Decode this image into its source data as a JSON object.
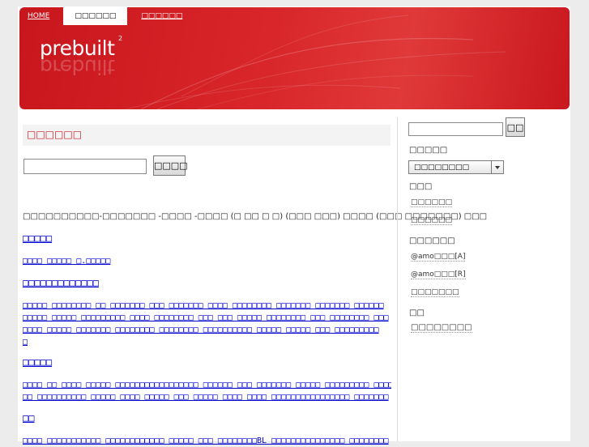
{
  "nav": {
    "home": "HOME",
    "tab_active": "□□□□□□",
    "tab_other": "□□□□□□"
  },
  "brand": {
    "name": "prebuilt",
    "superscript": "2"
  },
  "main": {
    "title": "□□□□□□",
    "search_button": "□□□□",
    "description": "□□□□□□□□□□-□□□□□□□ -□□□□ -□□□□ (□ □□ □ □) (□□□ □□□) □□□□ (□□□ □□□□□□□) □□□",
    "items": [
      {
        "kind": "heading",
        "lines": [
          "□□□□□"
        ]
      },
      {
        "kind": "para",
        "lines": [
          "□□□□ □□□□□ □.□□□□□"
        ]
      },
      {
        "kind": "heading",
        "lines": [
          "□□□□□□□□□□□□□"
        ]
      },
      {
        "kind": "para",
        "lines": [
          "□□□□□ □□□□□□□□ □□ □□□□□□□ □□□ □□□□□□□ □□□□ □□□□□□□□ □□□□□□□ □□□□□□□ □□□□□□",
          "□□□□□ □□□□□ □□□□□□□□□ □□□□ □□□□□□□□ □□□ □□□ □□□□□ □□□□□□□□ □□□ □□□□□□□□ □□□",
          "□□□□ □□□□□ □□□□□□□ □□□□□□□□ □□□□□□□□ □□□□□□□□□□ □□□□□ □□□□□ □□□ □□□□□□□□□",
          "□"
        ]
      },
      {
        "kind": "heading",
        "lines": [
          "□□□□□"
        ]
      },
      {
        "kind": "para",
        "lines": [
          "□□□□ □□ □□□□ □□□□□ □□□□□□□□□□□□□□□□□ □□□□□□ □□□ □□□□□□□ □□□□□ □□□□□□□□□ □□□□",
          "□□ □□□□□□□□□□ □□□□□ □□□□ □□□□□ □□□ □□□□□ □□□□ □□□□ □□□□□□□□□□□□□□□□ □□□□□□□"
        ]
      },
      {
        "kind": "heading",
        "lines": [
          "□□"
        ]
      },
      {
        "kind": "para",
        "lines": [
          "□□□□ □□□□□□□□□□□ □□□□□□□□□□□□ □□□□□ □□□ □□□□□□□□BL □□□□□□□□□□□□□□□ □□□□□□□□"
        ]
      }
    ]
  },
  "sidebar": {
    "search_button": "□□",
    "section1": "□□□□□",
    "select_value": "□□□□□□□□",
    "section2": "□□□",
    "links2": [
      "□□□□□□",
      "□□□□□□"
    ],
    "section3": "□□□□□□",
    "links3": [
      "@amo□□□[A]",
      "@amo□□□[R]",
      "□□□□□□□"
    ],
    "section4": "□□",
    "links4": [
      "□□□□□□□□"
    ]
  }
}
